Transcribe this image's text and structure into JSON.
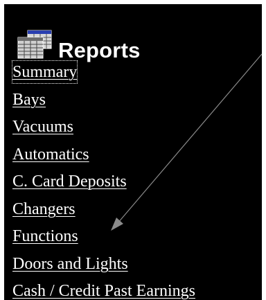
{
  "header": {
    "title": "Reports",
    "icon": "reports-table-icon"
  },
  "menu": {
    "items": [
      {
        "label": "Summary",
        "focused": true
      },
      {
        "label": "Bays"
      },
      {
        "label": "Vacuums"
      },
      {
        "label": "Automatics"
      },
      {
        "label": "C. Card Deposits"
      },
      {
        "label": "Changers"
      },
      {
        "label": "Functions"
      },
      {
        "label": "Doors and Lights"
      },
      {
        "label": "Cash / Credit Past Earnings"
      }
    ]
  },
  "annotation": {
    "color": "#8a8a8a",
    "points_to": "Functions"
  },
  "colors": {
    "background": "#000000",
    "text": "#ffffff"
  }
}
